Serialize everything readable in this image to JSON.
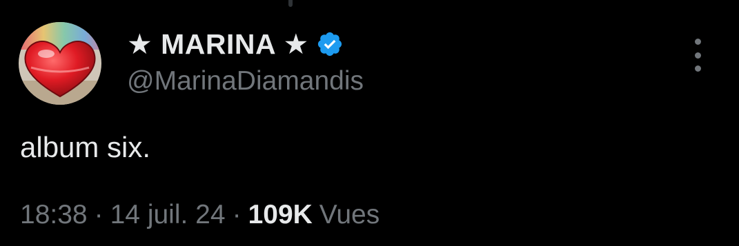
{
  "colors": {
    "background": "#000000",
    "primary_text": "#e7e9ea",
    "secondary_text": "#71767b",
    "verified_blue": "#1d9bf0"
  },
  "tweet": {
    "author": {
      "display_name": "★ MARINA ★",
      "handle": "@MarinaDiamandis",
      "verified": true,
      "avatar_icon": "red-heart-avatar"
    },
    "text": "album six.",
    "time": "18:38",
    "separator": "·",
    "date": "14 juil. 24",
    "views_count": "109K",
    "views_label": "Vues"
  },
  "icons": {
    "more": "more-vertical-icon",
    "verified": "verified-badge-icon"
  }
}
